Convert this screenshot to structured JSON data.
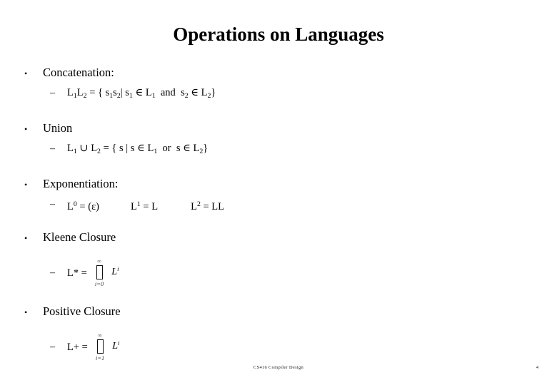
{
  "slide": {
    "title": "Operations on Languages",
    "bullet_marker": "•",
    "sub_marker": "–",
    "items": [
      {
        "label": "Concatenation:",
        "sub": [
          {
            "prefix": "L",
            "formula_html": "L1L2 = { s1s2| s1 ∈ L1  and  s2 ∈ L2}",
            "parts": {
              "L": "L",
              "one": "1",
              "two": "2",
              "eq": "=",
              "open": "{",
              "s": "s",
              "bar": "|",
              "in": "∈",
              "and": "and",
              "close": "}"
            }
          }
        ]
      },
      {
        "label": "Union",
        "sub": [
          {
            "parts": {
              "L": "L",
              "one": "1",
              "two": "2",
              "cup": "∪",
              "eq": "=",
              "open": "{",
              "s": "s",
              "bar": "|",
              "in": "∈",
              "or": "or",
              "close": "}"
            }
          }
        ]
      },
      {
        "label": "Exponentiation:",
        "sub": [
          {
            "parts": {
              "L": "L",
              "zero": "0",
              "one": "1",
              "two": "2",
              "eq": "=",
              "open": "(",
              "eps": "ε",
              "close": ")",
              "LL": "LL",
              "L_plain": "L"
            }
          }
        ]
      },
      {
        "label": "Kleene Closure",
        "sub": [
          {
            "lhs": "L* =",
            "op_top": "∞",
            "op_bottom": "i=0",
            "operand": "L",
            "operand_exp": "i"
          }
        ]
      },
      {
        "label": "Positive Closure",
        "sub": [
          {
            "lhs": "L+ =",
            "op_top": "∞",
            "op_bottom": "i=1",
            "operand": "L",
            "operand_exp": "i"
          }
        ]
      }
    ]
  },
  "footer": {
    "course": "CS416 Compiler Design",
    "page": "4"
  }
}
